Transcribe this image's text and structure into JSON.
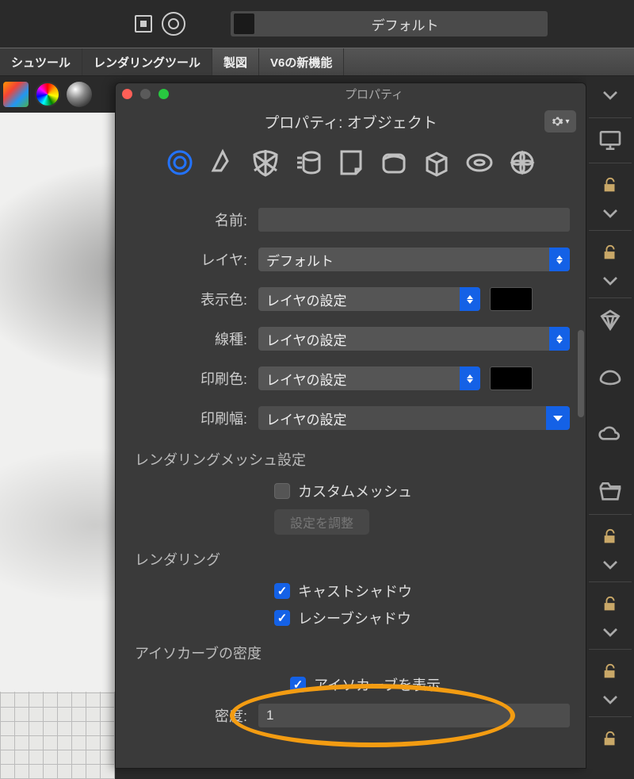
{
  "topbar": {
    "layer_label": "デフォルト"
  },
  "tabs": {
    "mesh_tools": "シュツール",
    "render_tools": "レンダリングツール",
    "drafting": "製図",
    "v6_new": "V6の新機能"
  },
  "panel": {
    "window_title": "プロパティ",
    "header": "プロパティ: オブジェクト",
    "gear_label": "✿",
    "labels": {
      "name": "名前:",
      "layer": "レイヤ:",
      "display_color": "表示色:",
      "linetype": "線種:",
      "print_color": "印刷色:",
      "print_width": "印刷幅:",
      "density": "密度:"
    },
    "values": {
      "name": "",
      "layer": "デフォルト",
      "display_color": "レイヤの設定",
      "linetype": "レイヤの設定",
      "print_color": "レイヤの設定",
      "print_width": "レイヤの設定",
      "density": "1"
    },
    "sections": {
      "render_mesh": "レンダリングメッシュ設定",
      "custom_mesh": "カスタムメッシュ",
      "adjust_settings": "設定を調整",
      "rendering": "レンダリング",
      "cast_shadow": "キャストシャドウ",
      "receive_shadow": "レシーブシャドウ",
      "isocurve_density": "アイソカーブの密度",
      "show_isocurve": "アイソカーブを表示"
    },
    "colors": {
      "accent": "#1461e6",
      "highlight": "#f39c12",
      "display_swatch": "#000000",
      "print_swatch": "#000000"
    }
  }
}
